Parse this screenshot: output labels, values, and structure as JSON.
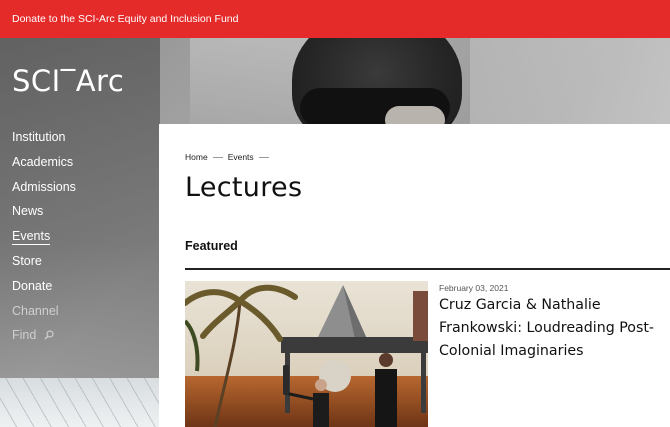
{
  "banner": {
    "text": "Donate to the SCI-Arc Equity and Inclusion Fund"
  },
  "logo": {
    "text": "SCI‾Arc"
  },
  "nav": {
    "items": [
      {
        "label": "Institution"
      },
      {
        "label": "Academics"
      },
      {
        "label": "Admissions"
      },
      {
        "label": "News"
      },
      {
        "label": "Events"
      },
      {
        "label": "Store"
      },
      {
        "label": "Donate"
      },
      {
        "label": "Channel"
      },
      {
        "label": "Find"
      }
    ],
    "active": "Events"
  },
  "breadcrumb": {
    "items": [
      "Home",
      "Events"
    ]
  },
  "page": {
    "title": "Lectures"
  },
  "featured": {
    "section_label": "Featured",
    "date": "February 03, 2021",
    "title": "Cruz Garcia & Nathalie Frankowski: Loudreading Post-Colonial Imaginaries"
  },
  "icons": {
    "find": "search-icon"
  },
  "colors": {
    "banner": "#e52a2a",
    "text": "#111111",
    "nav_text": "#ffffff"
  }
}
